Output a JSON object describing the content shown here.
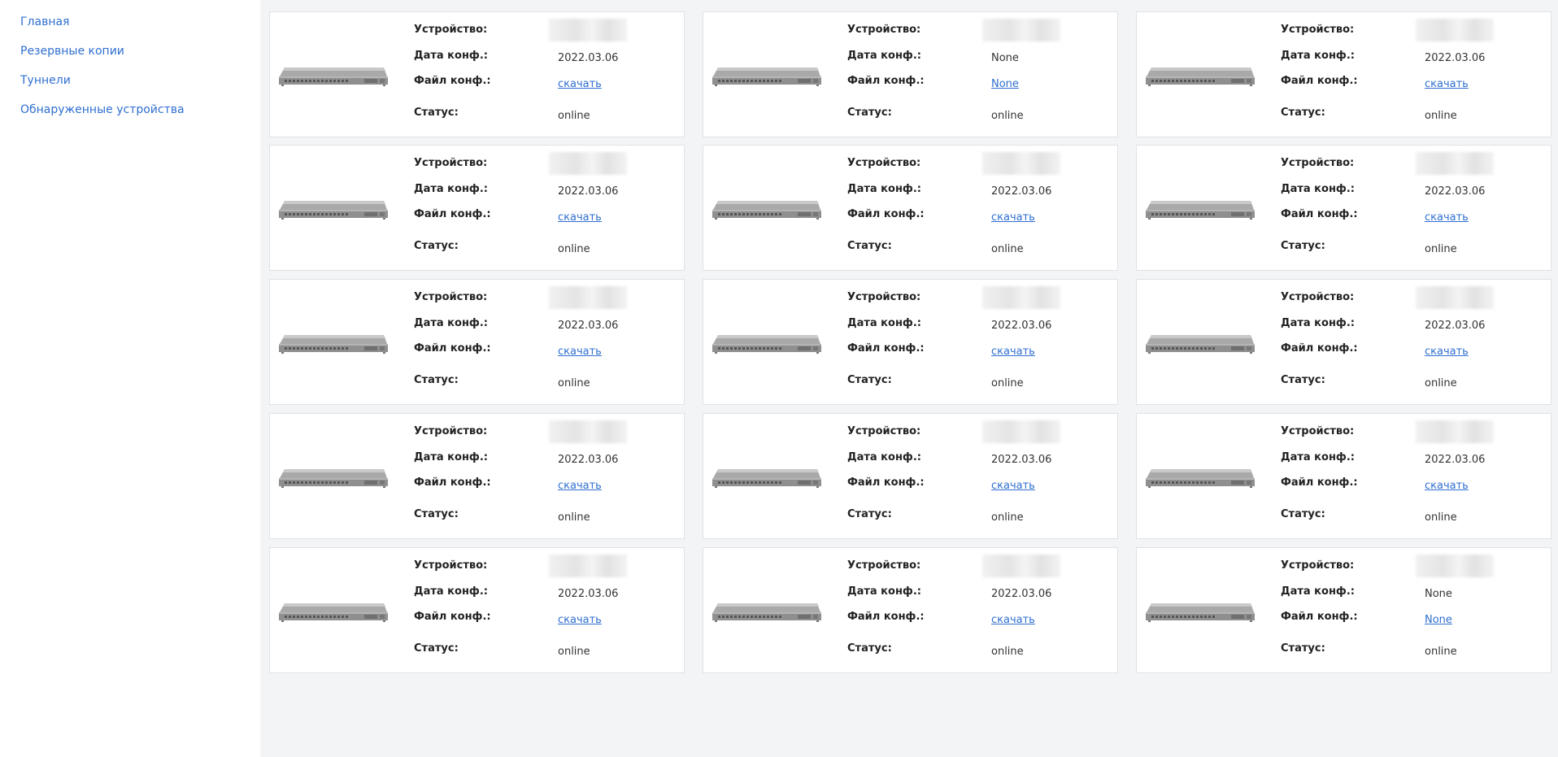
{
  "nav": {
    "items": [
      {
        "label": "Главная"
      },
      {
        "label": "Резервные копии"
      },
      {
        "label": "Туннели"
      },
      {
        "label": "Обнаруженные устройства"
      }
    ]
  },
  "labels": {
    "device": "Устройство:",
    "date": "Дата конф.:",
    "file": "Файл конф.:",
    "status": "Статус:"
  },
  "colors": {
    "link": "#2f6fd0",
    "main_bg": "#f3f4f6",
    "card_border": "#dfe2e6"
  },
  "cards": [
    {
      "date": "2022.03.06",
      "file": "скачать",
      "status": "online",
      "icon": "network-switch-icon"
    },
    {
      "date": "None",
      "file": "None",
      "status": "online",
      "icon": "network-switch-icon"
    },
    {
      "date": "2022.03.06",
      "file": "скачать",
      "status": "online",
      "icon": "network-switch-icon"
    },
    {
      "date": "2022.03.06",
      "file": "скачать",
      "status": "online",
      "icon": "network-switch-icon"
    },
    {
      "date": "2022.03.06",
      "file": "скачать",
      "status": "online",
      "icon": "network-switch-icon"
    },
    {
      "date": "2022.03.06",
      "file": "скачать",
      "status": "online",
      "icon": "network-switch-icon"
    },
    {
      "date": "2022.03.06",
      "file": "скачать",
      "status": "online",
      "icon": "network-switch-icon"
    },
    {
      "date": "2022.03.06",
      "file": "скачать",
      "status": "online",
      "icon": "network-switch-icon"
    },
    {
      "date": "2022.03.06",
      "file": "скачать",
      "status": "online",
      "icon": "network-switch-icon"
    },
    {
      "date": "2022.03.06",
      "file": "скачать",
      "status": "online",
      "icon": "network-switch-icon"
    },
    {
      "date": "2022.03.06",
      "file": "скачать",
      "status": "online",
      "icon": "network-switch-icon"
    },
    {
      "date": "2022.03.06",
      "file": "скачать",
      "status": "online",
      "icon": "network-switch-icon"
    },
    {
      "date": "2022.03.06",
      "file": "скачать",
      "status": "online",
      "icon": "network-switch-icon"
    },
    {
      "date": "2022.03.06",
      "file": "скачать",
      "status": "online",
      "icon": "network-switch-icon"
    },
    {
      "date": "None",
      "file": "None",
      "status": "online",
      "icon": "network-switch-icon"
    }
  ]
}
